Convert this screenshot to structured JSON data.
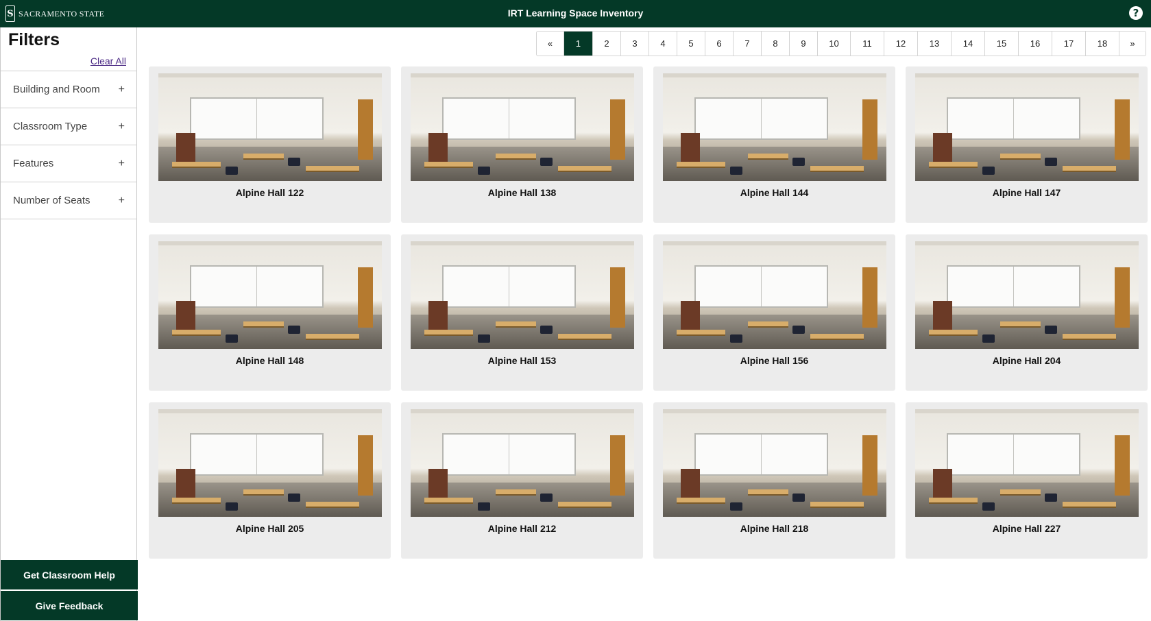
{
  "header": {
    "logo_mark": "S",
    "logo_text": "SACRAMENTO STATE",
    "title": "IRT Learning Space Inventory",
    "help_icon": "?"
  },
  "sidebar": {
    "title": "Filters",
    "clear_all": "Clear All",
    "filters": [
      {
        "label": "Building and Room",
        "icon": "+"
      },
      {
        "label": "Classroom Type",
        "icon": "+"
      },
      {
        "label": "Features",
        "icon": "+"
      },
      {
        "label": "Number of Seats",
        "icon": "+"
      }
    ],
    "help_button": "Get Classroom Help",
    "feedback_button": "Give Feedback"
  },
  "pagination": {
    "prev": "«",
    "next": "»",
    "pages": [
      "1",
      "2",
      "3",
      "4",
      "5",
      "6",
      "7",
      "8",
      "9",
      "10",
      "11",
      "12",
      "13",
      "14",
      "15",
      "16",
      "17",
      "18"
    ],
    "current": "1"
  },
  "rooms": [
    {
      "name": "Alpine Hall 122"
    },
    {
      "name": "Alpine Hall 138"
    },
    {
      "name": "Alpine Hall 144"
    },
    {
      "name": "Alpine Hall 147"
    },
    {
      "name": "Alpine Hall 148"
    },
    {
      "name": "Alpine Hall 153"
    },
    {
      "name": "Alpine Hall 156"
    },
    {
      "name": "Alpine Hall 204"
    },
    {
      "name": "Alpine Hall 205"
    },
    {
      "name": "Alpine Hall 212"
    },
    {
      "name": "Alpine Hall 218"
    },
    {
      "name": "Alpine Hall 227"
    }
  ],
  "colors": {
    "brand_green": "#043927",
    "link_purple": "#4b2a85",
    "card_bg": "#ececec"
  }
}
